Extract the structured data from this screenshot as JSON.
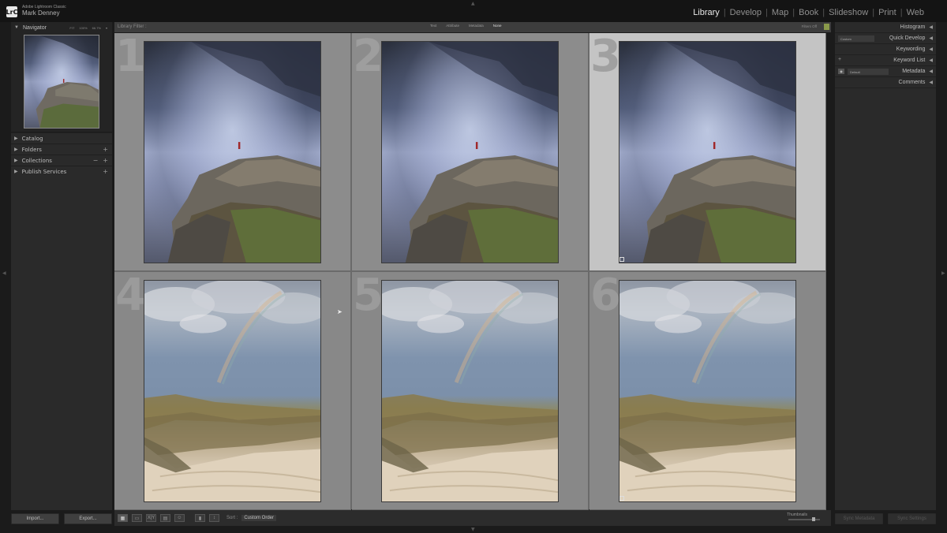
{
  "app": {
    "logo_text": "LrC",
    "product": "Adobe Lightroom Classic",
    "user": "Mark Denney"
  },
  "modules": [
    "Library",
    "Develop",
    "Map",
    "Book",
    "Slideshow",
    "Print",
    "Web"
  ],
  "active_module": "Library",
  "left_panel": {
    "navigator": {
      "title": "Navigator",
      "zoom_options": [
        "FIT",
        "100%",
        "66.7%"
      ]
    },
    "sections": [
      {
        "label": "Catalog",
        "plus": false,
        "minus": false
      },
      {
        "label": "Folders",
        "plus": true,
        "minus": false
      },
      {
        "label": "Collections",
        "plus": true,
        "minus": true
      },
      {
        "label": "Publish Services",
        "plus": true,
        "minus": false
      }
    ],
    "import_label": "Import...",
    "export_label": "Export..."
  },
  "filter_bar": {
    "title": "Library Filter :",
    "tabs": [
      "Text",
      "Attribute",
      "Metadata",
      "None"
    ],
    "active_tab": "None",
    "filters_off": "Filters Off"
  },
  "grid": {
    "cells": [
      {
        "number": "1",
        "scene": "mountain",
        "selected": false
      },
      {
        "number": "2",
        "scene": "mountain",
        "selected": false
      },
      {
        "number": "3",
        "scene": "mountain",
        "selected": true
      },
      {
        "number": "4",
        "scene": "beach",
        "selected": false
      },
      {
        "number": "5",
        "scene": "beach",
        "selected": false
      },
      {
        "number": "6",
        "scene": "beach",
        "selected": false
      }
    ]
  },
  "toolbar": {
    "sort_label": "Sort :",
    "sort_value": "Custom Order",
    "thumbnails_label": "Thumbnails"
  },
  "right_panel": {
    "rows": [
      {
        "label": "Histogram"
      },
      {
        "label": "Quick Develop",
        "control": "Custom"
      },
      {
        "label": "Keywording"
      },
      {
        "label": "Keyword List"
      },
      {
        "label": "Metadata",
        "control": "Default"
      },
      {
        "label": "Comments"
      }
    ],
    "sync_metadata_label": "Sync Metadata",
    "sync_settings_label": "Sync Settings"
  }
}
